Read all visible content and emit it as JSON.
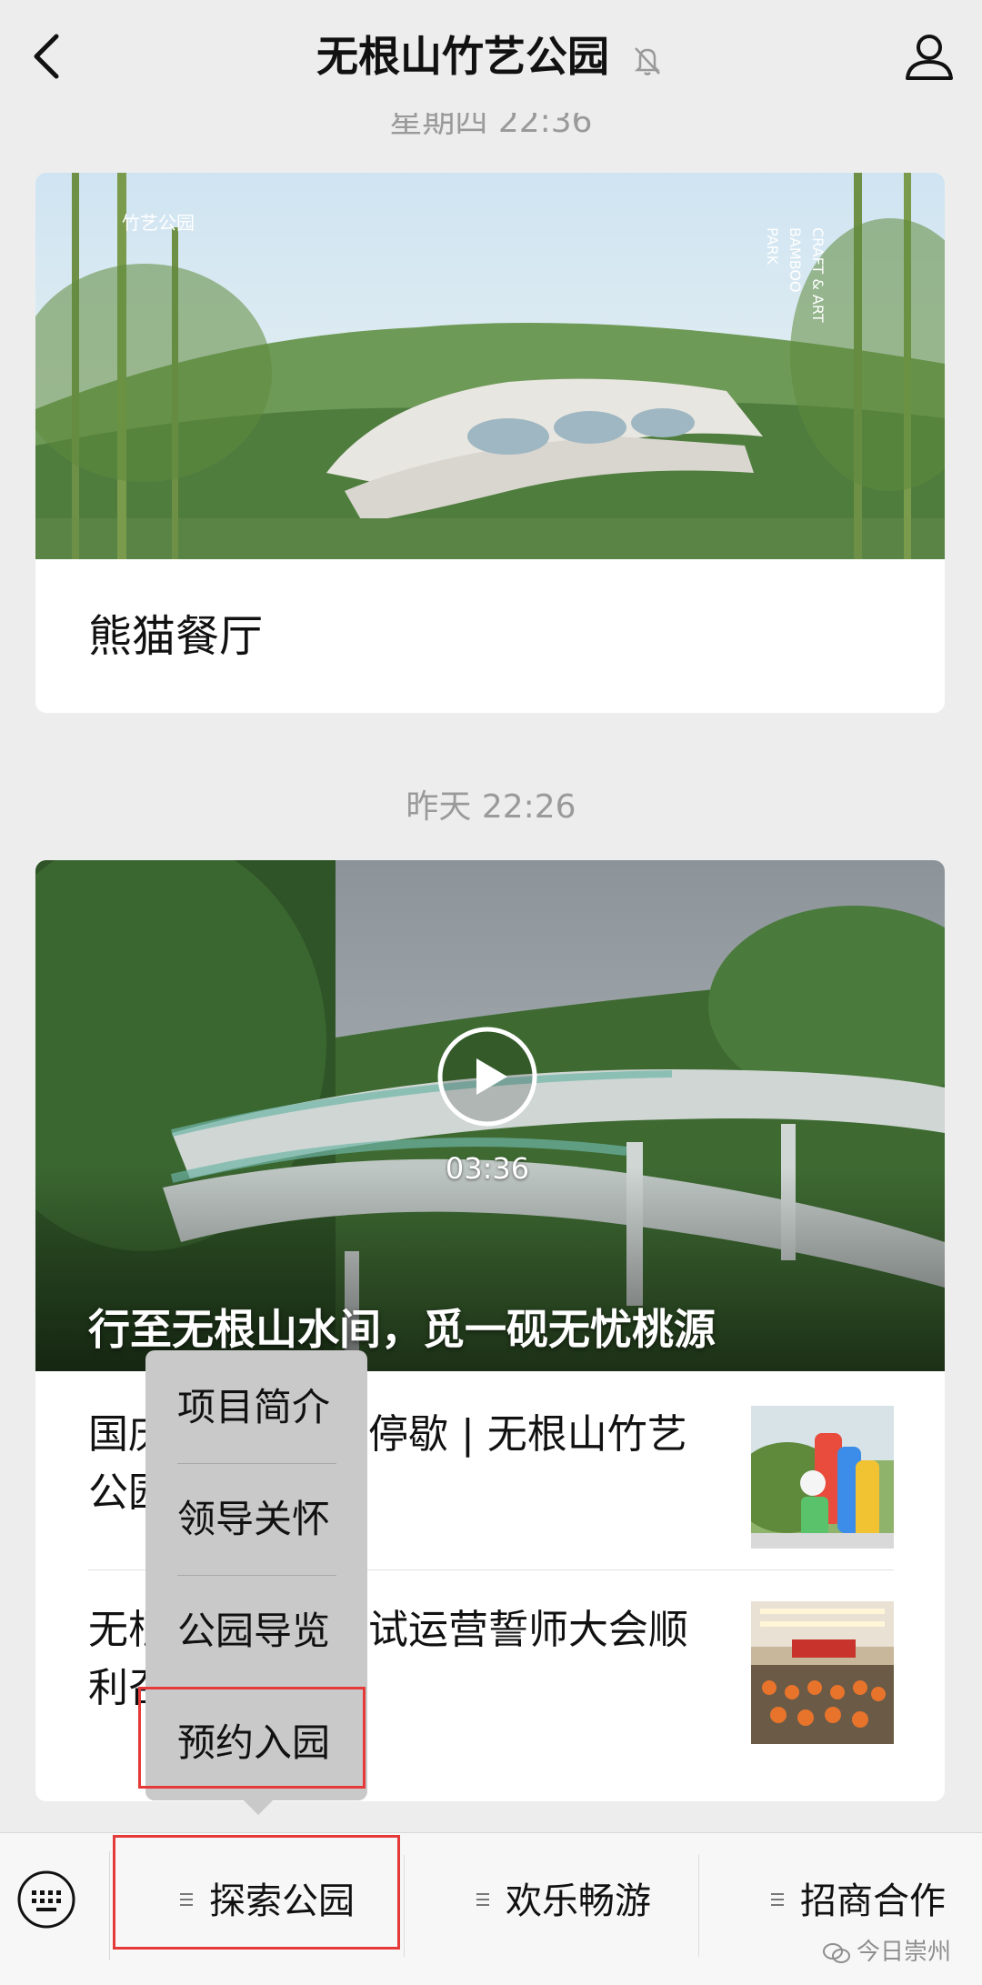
{
  "header": {
    "title": "无根山竹艺公园"
  },
  "feed": {
    "timestamp_1": "星期四 22:36",
    "card_1": {
      "title": "熊猫餐厅"
    },
    "timestamp_2": "昨天 22:26",
    "card_2": {
      "video_duration": "03:36",
      "video_caption": "行至无根山水间，觅一砚无忧桃源",
      "articles": [
        {
          "title": "国庆假期欢乐不停歇 | 无根山竹艺公园"
        },
        {
          "title": "无根山竹艺公园试运营誓师大会顺利召开"
        }
      ]
    }
  },
  "popup_menu": {
    "items": [
      "项目简介",
      "领导关怀",
      "公园导览",
      "预约入园"
    ]
  },
  "bottom_menu": {
    "tabs": [
      "探索公园",
      "欢乐畅游",
      "招商合作"
    ]
  },
  "watermark": {
    "text": "今日崇州"
  },
  "colors": {
    "highlight_box": "#e63a3a",
    "popup_bg": "#c9c9c9",
    "page_bg": "#ededed"
  }
}
